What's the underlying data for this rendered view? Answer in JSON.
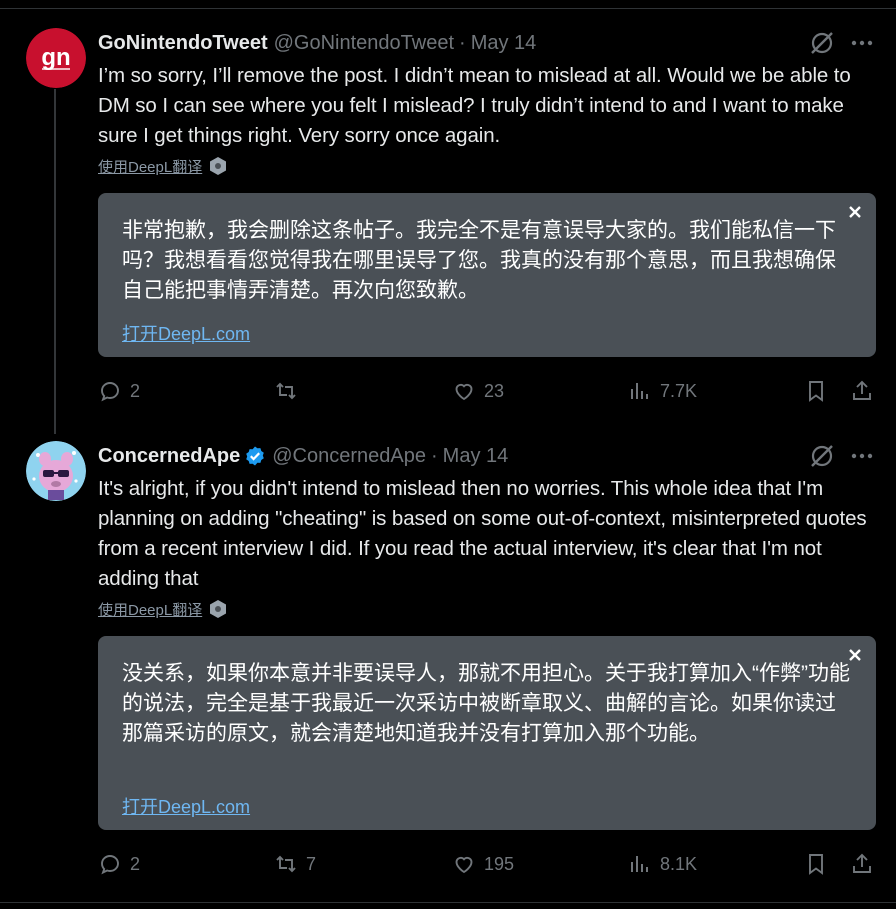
{
  "tweets": [
    {
      "name": "GoNintendoTweet",
      "handle": "@GoNintendoTweet",
      "separator": "·",
      "date": "May 14",
      "avatar_text": "gn",
      "text": "I’m so sorry, I’ll remove the post. I didn’t mean to mislead at all. Would we be able to DM so I can see where you felt I mislead? I truly didn’t intend to and I want to make sure I get things right. Very sorry once again.",
      "translate_link": "使用DeepL翻译",
      "translation": "非常抱歉，我会删除这条帖子。我完全不是有意误导大家的。我们能私信一下吗？我想看看您觉得我在哪里误导了您。我真的没有那个意思，而且我想确保自己能把事情弄清楚。再次向您致歉。",
      "open_deepl": "打开DeepL.com",
      "replies": "2",
      "retweets": "",
      "likes": "23",
      "views": "7.7K",
      "verified": false
    },
    {
      "name": "ConcernedApe",
      "handle": "@ConcernedApe",
      "separator": "·",
      "date": "May 14",
      "text": "It's alright, if you didn't intend to mislead then no worries. This whole idea that I'm planning on adding \"cheating\" is based on some out-of-context, misinterpreted quotes from a recent interview I did. If you read the actual interview, it's clear that I'm not adding that",
      "translate_link": "使用DeepL翻译",
      "translation": "没关系，如果你本意并非要误导人，那就不用担心。关于我打算加入“作弊”功能的说法，完全是基于我最近一次采访中被断章取义、曲解的言论。如果你读过那篇采访的原文，就会清楚地知道我并没有打算加入那个功能。",
      "open_deepl": "打开DeepL.com",
      "replies": "2",
      "retweets": "7",
      "likes": "195",
      "views": "8.1K",
      "verified": true
    }
  ],
  "colors": {
    "background": "#000000",
    "text": "#e7e9ea",
    "muted": "#71767b",
    "translation_box": "#4a5056",
    "link": "#6fb7f2",
    "verified": "#1d9bf0",
    "gn_red": "#c8102e"
  },
  "icons": [
    "grok-icon",
    "more-icon",
    "reply-icon",
    "retweet-icon",
    "like-icon",
    "views-icon",
    "bookmark-icon",
    "share-icon",
    "deepl-icon",
    "close-icon",
    "verified-icon"
  ]
}
